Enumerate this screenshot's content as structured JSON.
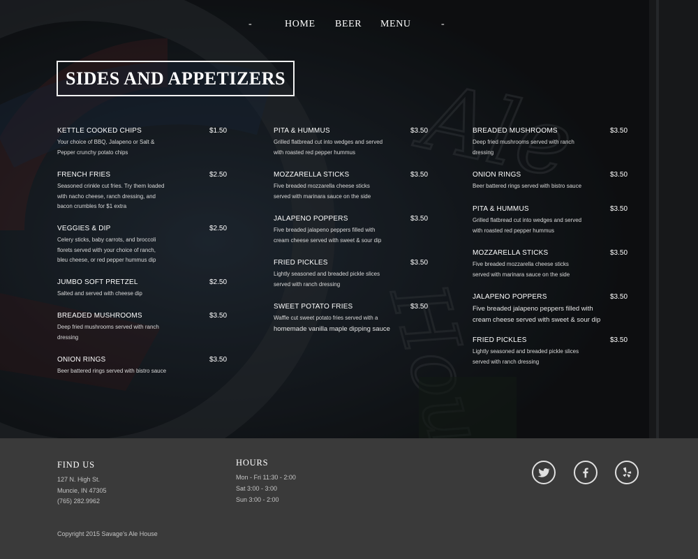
{
  "nav": {
    "left_dash": "-",
    "items": [
      {
        "label": "HOME"
      },
      {
        "label": "BEER"
      },
      {
        "label": "MENU"
      }
    ],
    "right_dash": "-"
  },
  "page_title": "SIDES AND APPETIZERS",
  "menu": {
    "columns": [
      [
        {
          "name": "KETTLE COOKED CHIPS",
          "price": "$1.50",
          "description": "Your choice of BBQ, Jalapeno or Salt &\nPepper crunchy potato chips"
        },
        {
          "name": "FRENCH FRIES",
          "price": "$2.50",
          "description": "Seasoned crinkle cut fries. Try them loaded\nwith nacho cheese, ranch dressing, and\nbacon crumbles for $1 extra"
        },
        {
          "name": "VEGGIES & DIP",
          "price": "$2.50",
          "description": "Celery sticks, baby carrots, and broccoli\nflorets served with your choice of ranch,\nbleu cheese, or red pepper hummus dip"
        },
        {
          "name": "JUMBO SOFT PRETZEL",
          "price": "$2.50",
          "description": "Salted and served with cheese dip"
        },
        {
          "name": "BREADED MUSHROOMS",
          "price": "$3.50",
          "description": "Deep fried mushrooms served with ranch\ndressing"
        },
        {
          "name": "ONION RINGS",
          "price": "$3.50",
          "description": "Beer battered rings served with bistro sauce"
        }
      ],
      [
        {
          "name": "PITA & HUMMUS",
          "price": "$3.50",
          "description": "Grilled flatbread cut into wedges and served\nwith roasted red pepper hummus"
        },
        {
          "name": "MOZZARELLA STICKS",
          "price": "$3.50",
          "description": "Five breaded mozzarella cheese sticks\nserved with marinara sauce on the side"
        },
        {
          "name": "JALAPENO POPPERS",
          "price": "$3.50",
          "description": "Five breaded jalapeno peppers filled with\ncream cheese served with sweet & sour dip"
        },
        {
          "name": "FRIED PICKLES",
          "price": "$3.50",
          "description": "Lightly seasoned and breaded pickle slices\nserved with ranch dressing"
        },
        {
          "name": "SWEET POTATO FRIES",
          "price": "$3.50",
          "description": "Waffle cut sweet potato fries served with a",
          "description_2": "homemade vanilla maple dipping sauce"
        }
      ],
      [
        {
          "name": "BREADED MUSHROOMS",
          "price": "$3.50",
          "description": "Deep fried mushrooms served with ranch\ndressing"
        },
        {
          "name": "ONION RINGS",
          "price": "$3.50",
          "description": "Beer battered rings served with bistro sauce"
        },
        {
          "name": "PITA & HUMMUS",
          "price": "$3.50",
          "description": "Grilled flatbread cut into wedges and served\nwith roasted red pepper hummus"
        },
        {
          "name": "MOZZARELLA STICKS",
          "price": "$3.50",
          "description": "Five breaded mozzarella cheese sticks\nserved with marinara sauce on the side"
        },
        {
          "name": "JALAPENO POPPERS",
          "price": "$3.50",
          "description": "Five breaded jalapeno peppers filled with\ncream cheese served with sweet & sour dip"
        },
        {
          "name": "FRIED PICKLES",
          "price": "$3.50",
          "description": "Lightly seasoned and breaded pickle slices\nserved with ranch dressing"
        }
      ]
    ]
  },
  "footer": {
    "find_us": {
      "heading": "FIND US",
      "address_1": "127 N. High St.",
      "address_2": "Muncie, IN 47305",
      "phone": "(765) 282.9962"
    },
    "hours": {
      "heading": "HOURS",
      "line_1": "Mon - Fri 11:30 - 2:00",
      "line_2": "Sat 3:00 - 3:00",
      "line_3": "Sun 3:00 - 2:00"
    },
    "social": [
      {
        "icon": "twitter-icon"
      },
      {
        "icon": "facebook-icon"
      },
      {
        "icon": "yelp-icon"
      }
    ],
    "copyright": "Copyright 2015 Savage's Ale House"
  },
  "colors": {
    "footer_bg": "#3a3a3a",
    "text": "#ffffff",
    "muted_text": "#c4c4c4"
  }
}
